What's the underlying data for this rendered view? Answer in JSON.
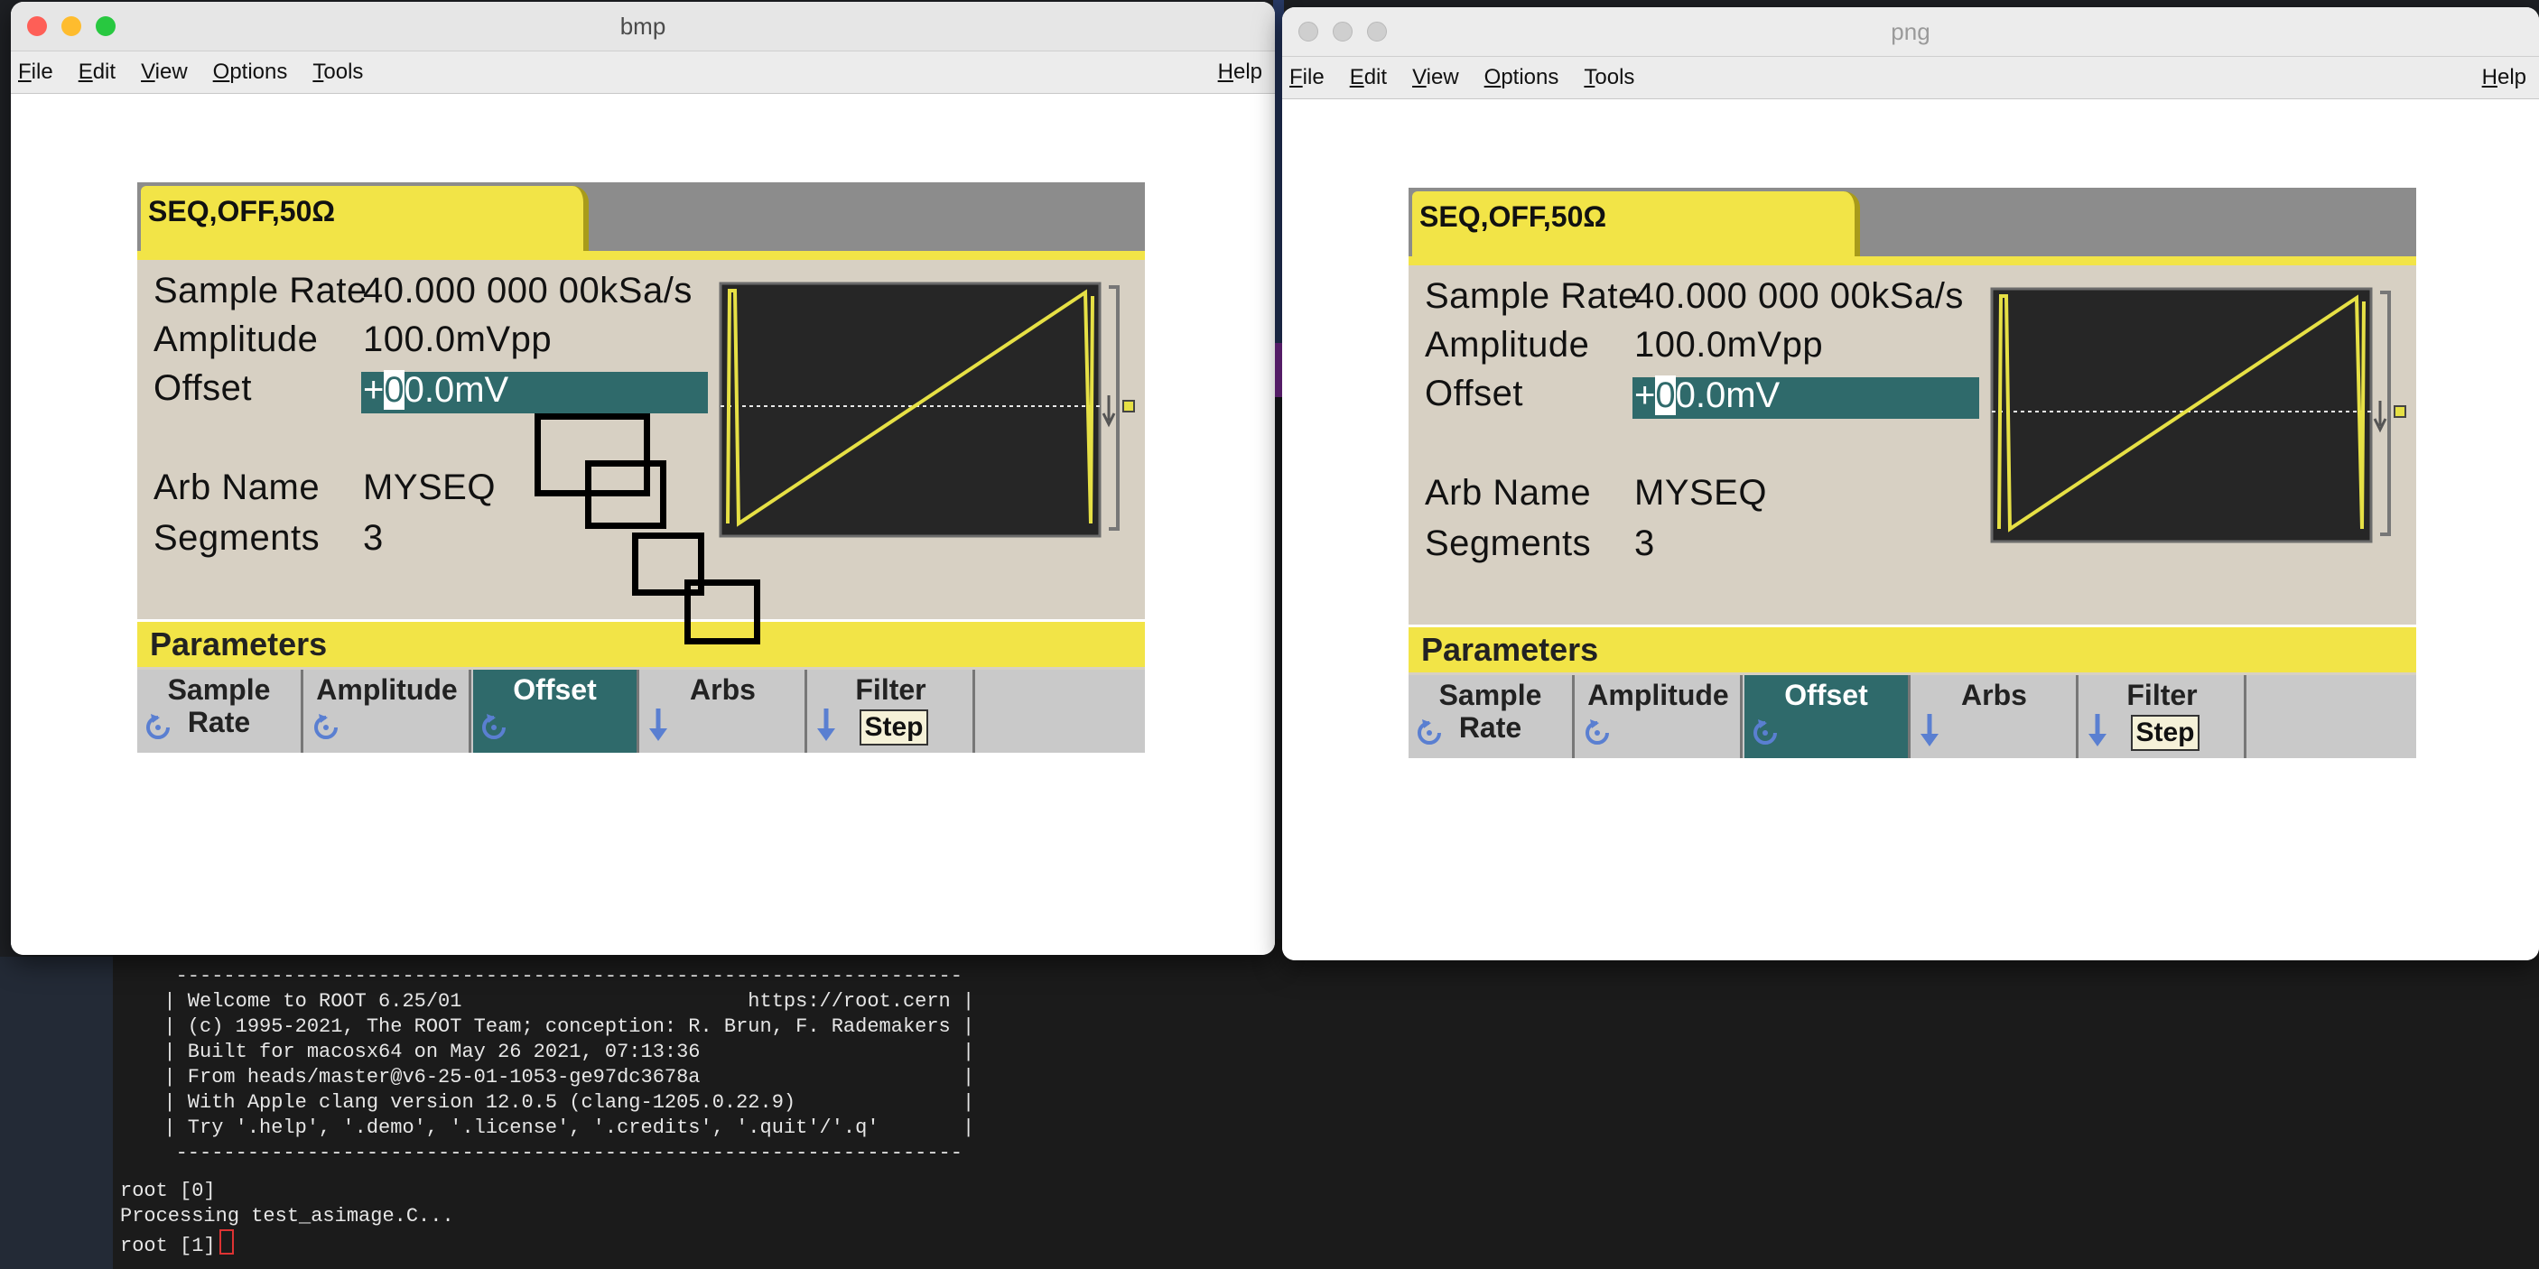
{
  "windows": [
    {
      "title": "bmp",
      "active": true
    },
    {
      "title": "png",
      "active": false
    }
  ],
  "menubar": {
    "items": [
      {
        "label": "File",
        "u": "F",
        "rest": "ile"
      },
      {
        "label": "Edit",
        "u": "E",
        "rest": "dit"
      },
      {
        "label": "View",
        "u": "V",
        "rest": "iew"
      },
      {
        "label": "Options",
        "u": "O",
        "rest": "ptions"
      },
      {
        "label": "Tools",
        "u": "T",
        "rest": "ools"
      }
    ],
    "help": {
      "label": "Help",
      "u": "H",
      "rest": "elp"
    }
  },
  "instrument": {
    "status_tab": "SEQ,OFF,50Ω",
    "params": [
      {
        "label": "Sample Rate",
        "value": "40.000 000 00kSa/s"
      },
      {
        "label": "Amplitude",
        "value": "100.0mVpp"
      },
      {
        "label": "Offset",
        "value_prefix": "+",
        "value_cursor": "0",
        "value_rest": "0.0mV"
      },
      {
        "label": "Arb Name",
        "value": "MYSEQ"
      },
      {
        "label": "Segments",
        "value": "3"
      }
    ],
    "parameters_bar": "Parameters",
    "softkeys": [
      {
        "line1": "Sample",
        "line2": "Rate",
        "icon": "rotate-icon",
        "active": false
      },
      {
        "line1": "Amplitude",
        "line2": "",
        "icon": "rotate-icon",
        "active": false
      },
      {
        "line1": "Offset",
        "line2": "",
        "icon": "rotate-icon",
        "active": true
      },
      {
        "line1": "Arbs",
        "line2": "",
        "icon": "arrow-down-icon",
        "active": false
      },
      {
        "line1": "Filter",
        "line2": "",
        "sub": "Step",
        "icon": "arrow-down-icon",
        "active": false
      },
      {
        "line1": "",
        "line2": "",
        "icon": "",
        "active": false
      }
    ]
  },
  "terminal": {
    "banner": [
      "   ------------------------------------------------------------------",
      "  | Welcome to ROOT 6.25/01                        https://root.cern |",
      "  | (c) 1995-2021, The ROOT Team; conception: R. Brun, F. Rademakers |",
      "  | Built for macosx64 on May 26 2021, 07:13:36                      |",
      "  | From heads/master@v6-25-01-1053-ge97dc3678a                      |",
      "  | With Apple clang version 12.0.5 (clang-1205.0.22.9)              |",
      "  | Try '.help', '.demo', '.license', '.credits', '.quit'/'.q'       |",
      "   ------------------------------------------------------------------"
    ],
    "lines": [
      "root [0]",
      "Processing test_asimage.C...",
      "root [1]"
    ]
  },
  "colors": {
    "instrument_yellow": "#f2e447",
    "instrument_teal": "#2f6a6b",
    "instrument_body": "#d7d0c3"
  }
}
